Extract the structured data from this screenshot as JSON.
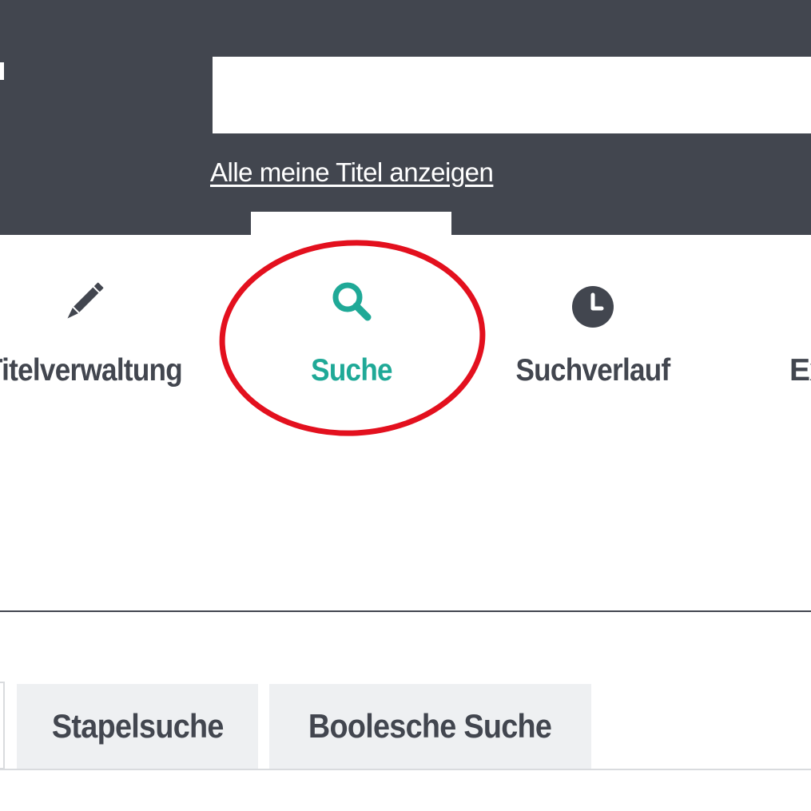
{
  "header": {
    "search_value": "",
    "all_titles_link": "Alle meine Titel anzeigen"
  },
  "nav": {
    "items": [
      {
        "label": "Titelverwaltung",
        "icon": "pencil-icon",
        "active": false
      },
      {
        "label": "Suche",
        "icon": "search-icon",
        "active": true
      },
      {
        "label": "Suchverlauf",
        "icon": "clock-icon",
        "active": false
      },
      {
        "label": "Ex",
        "icon": "",
        "active": false
      }
    ]
  },
  "search_tabs": [
    {
      "label": "Stapelsuche"
    },
    {
      "label": "Boolesche Suche"
    }
  ],
  "colors": {
    "header_bg": "#42464f",
    "accent": "#1fa997",
    "text": "#42464f",
    "tab_bg": "#eef0f2",
    "annotation": "#e3101e"
  }
}
